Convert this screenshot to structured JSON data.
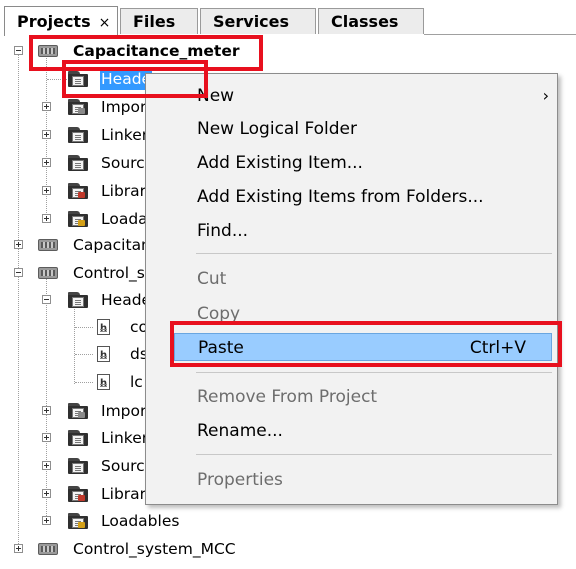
{
  "tabs": [
    {
      "label": "Projects",
      "close": "×",
      "active": true
    },
    {
      "label": "Files"
    },
    {
      "label": "Services"
    },
    {
      "label": "Classes"
    }
  ],
  "tree": {
    "project1": "Capacitance_meter",
    "project1_children": [
      "Heade",
      "Impor",
      "Linker",
      "Sourc",
      "Librar",
      "Loada"
    ],
    "project2": "Capacitan",
    "project3": "Control_sy",
    "project3_children": [
      "Heade",
      "Impor",
      "Linker",
      "Sourc",
      "Librar",
      "Loadables"
    ],
    "project3_header_files": [
      "co",
      "ds",
      "lc"
    ],
    "project4": "Control_system_MCC"
  },
  "context_menu": {
    "new": "New",
    "new_logical_folder": "New Logical Folder",
    "add_existing_item": "Add Existing Item...",
    "add_existing_items_folders": "Add Existing Items from Folders...",
    "find": "Find...",
    "cut": "Cut",
    "copy": "Copy",
    "paste": "Paste",
    "paste_shortcut": "Ctrl+V",
    "remove_from_project": "Remove From Project",
    "rename": "Rename...",
    "properties": "Properties"
  },
  "colors": {
    "selection": "#3399ff",
    "menu_highlight": "#99ccff",
    "annotation": "#e8101e"
  },
  "icons": {
    "project": "chip-project-icon",
    "folder": "logical-folder-icon",
    "file": "header-file-icon",
    "expand": "tree-expand-icon",
    "collapse": "tree-collapse-icon"
  }
}
